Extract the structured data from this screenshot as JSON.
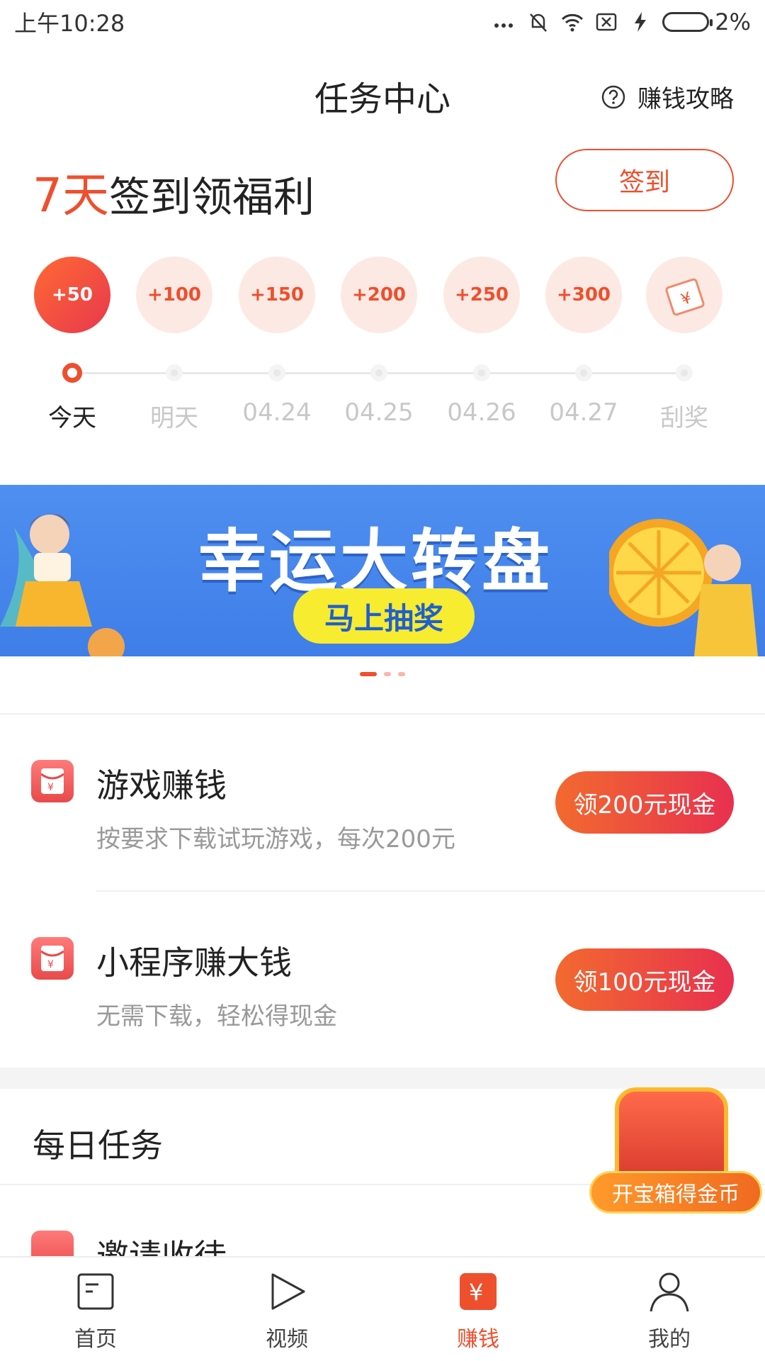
{
  "status_bar": {
    "time": "上午10:28",
    "battery": "2%"
  },
  "header": {
    "title": "任务中心",
    "help_label": "赚钱攻略"
  },
  "signin": {
    "title_highlight": "7天",
    "title_rest": "签到领福利",
    "button_label": "签到",
    "days": [
      {
        "reward": "+50",
        "label": "今天",
        "active": true
      },
      {
        "reward": "+100",
        "label": "明天",
        "active": false
      },
      {
        "reward": "+150",
        "label": "04.24",
        "active": false
      },
      {
        "reward": "+200",
        "label": "04.25",
        "active": false
      },
      {
        "reward": "+250",
        "label": "04.26",
        "active": false
      },
      {
        "reward": "+300",
        "label": "04.27",
        "active": false
      },
      {
        "reward": "",
        "label": "刮奖",
        "active": false
      }
    ]
  },
  "banner": {
    "title": "幸运大转盘",
    "button_label": "马上抽奖",
    "dots": 3,
    "active_dot": 0
  },
  "tasks": [
    {
      "title": "游戏赚钱",
      "subtitle": "按要求下载试玩游戏，每次200元",
      "button_label": "领200元现金"
    },
    {
      "title": "小程序赚大钱",
      "subtitle": "无需下载，轻松得现金",
      "button_label": "领100元现金"
    }
  ],
  "daily": {
    "title": "每日任务",
    "chest_label": "开宝箱得金币",
    "first_item": "邀请收徒"
  },
  "nav": [
    {
      "label": "首页",
      "icon": "home-icon",
      "active": false
    },
    {
      "label": "视频",
      "icon": "play-icon",
      "active": false
    },
    {
      "label": "赚钱",
      "icon": "yuan-icon",
      "active": true
    },
    {
      "label": "我的",
      "icon": "user-icon",
      "active": false
    }
  ],
  "colors": {
    "accent": "#ee4f2d",
    "banner_blue": "#4f8ff0"
  }
}
